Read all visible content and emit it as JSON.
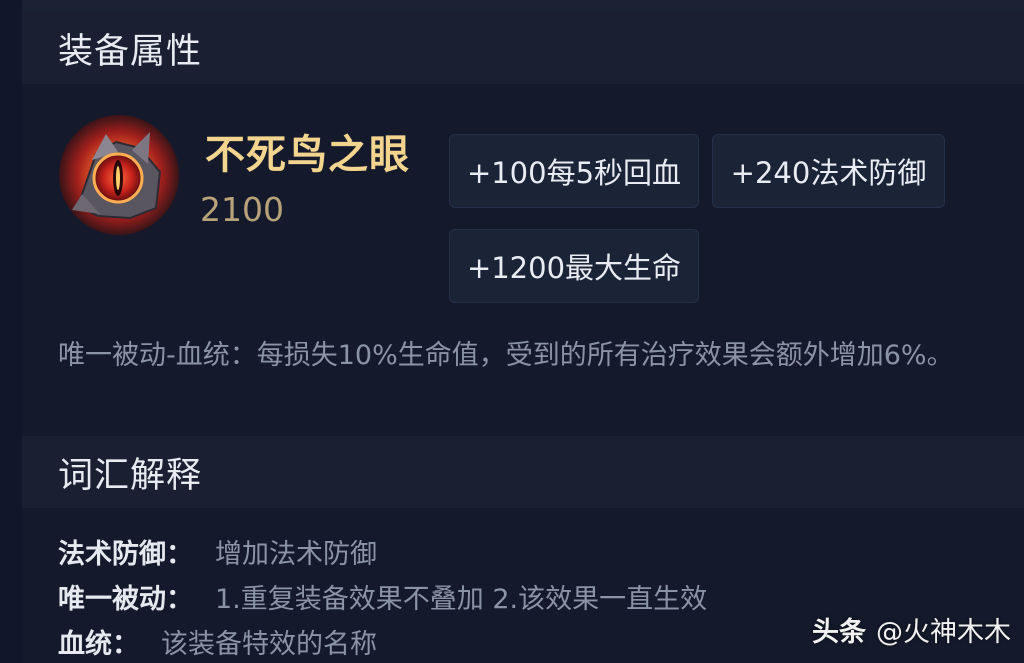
{
  "attributes": {
    "title": "装备属性",
    "item": {
      "icon": "phoenix-eye-icon",
      "name": "不死鸟之眼",
      "price": "2100"
    },
    "stats": [
      {
        "label": "+100每5秒回血"
      },
      {
        "label": "+240法术防御"
      },
      {
        "label": "+1200最大生命"
      }
    ],
    "passive_description": "唯一被动-血统：每损失10%生命值，受到的所有治疗效果会额外增加6%。"
  },
  "vocabulary": {
    "title": "词汇解释",
    "entries": [
      {
        "term": "法术防御：",
        "definition": "增加法术防御"
      },
      {
        "term": "唯一被动：",
        "definition": "1.重复装备效果不叠加 2.该效果一直生效"
      },
      {
        "term": "血统：",
        "definition": "该装备特效的名称"
      }
    ]
  },
  "watermark": {
    "brand": "头条",
    "author": "@火神木木"
  },
  "colors": {
    "background": "#141a2a",
    "header_bg": "#1a2032",
    "item_name": "#f4d590",
    "price": "#b8a27a",
    "chip_bg": "#1b2336",
    "muted_text": "#8b93a6"
  }
}
